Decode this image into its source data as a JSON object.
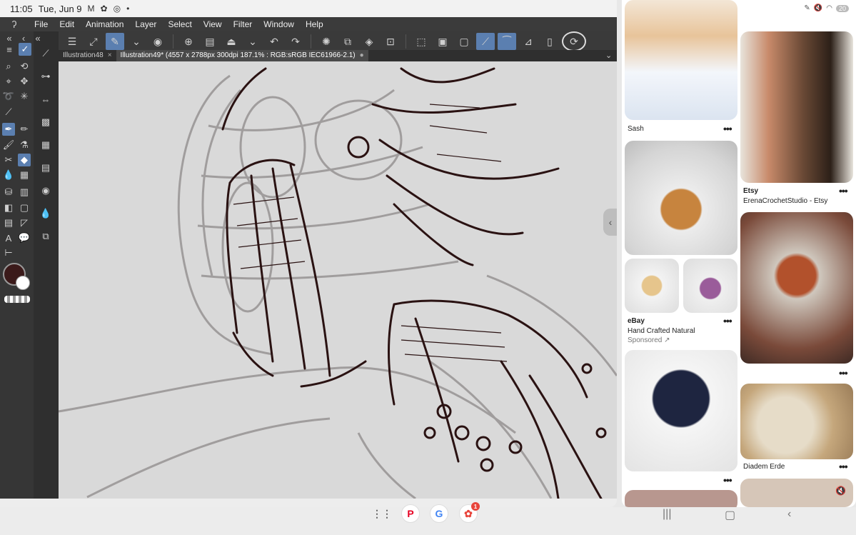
{
  "status_bar": {
    "time": "11:05",
    "date": "Tue, Jun 9",
    "icons": [
      "gmail-icon",
      "flower-icon",
      "game-icon",
      "dot-icon"
    ]
  },
  "menu": {
    "items": [
      "File",
      "Edit",
      "Animation",
      "Layer",
      "Select",
      "View",
      "Filter",
      "Window",
      "Help"
    ]
  },
  "tabs": [
    {
      "label": "Illustration48",
      "active": false
    },
    {
      "label": "Illustration49* (4557 x 2788px 300dpi 187.1% : RGB:sRGB IEC61966-2.1)",
      "active": true
    }
  ],
  "colors": {
    "main": "#3b1a1a",
    "sub": "#ffffff",
    "accent": "#5b7fb0",
    "stroke": "#2a1212",
    "guide": "#8e8a8a"
  },
  "pinterest": {
    "status": {
      "battery": "20"
    },
    "left_column": [
      {
        "caption_title": "Sash",
        "subtitle": "",
        "sponsored": ""
      },
      {
        "caption_title": "eBay",
        "subtitle": "Hand Crafted Natural",
        "sponsored": "Sponsored ↗"
      },
      {
        "caption_title": "",
        "subtitle": "",
        "sponsored": ""
      }
    ],
    "right_column": [
      {
        "caption_title": "Etsy",
        "subtitle": "ErenaCrochetStudio - Etsy"
      },
      {
        "caption_title": "",
        "subtitle": ""
      },
      {
        "caption_title": "Diadem Erde",
        "subtitle": ""
      }
    ]
  },
  "dock": {
    "notification_badge": "1"
  }
}
